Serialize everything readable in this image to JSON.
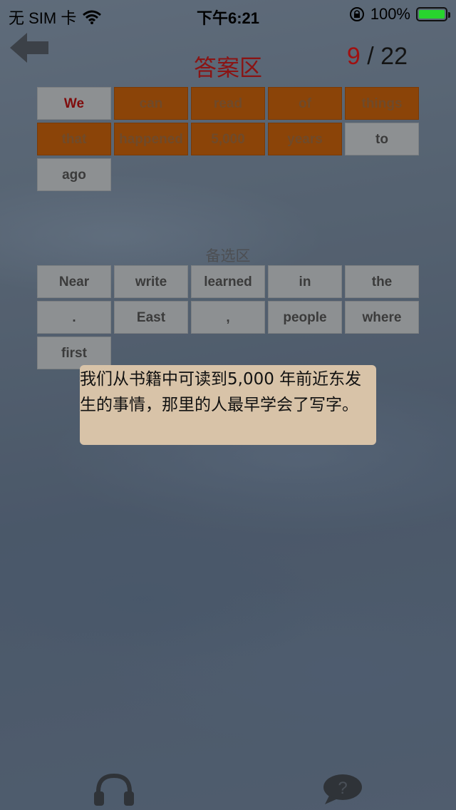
{
  "status_bar": {
    "carrier": "无 SIM 卡",
    "time": "下午6:21",
    "battery": "100%"
  },
  "header": {
    "title": "答案区",
    "counter_current": "9",
    "counter_sep": " / ",
    "counter_total": "22"
  },
  "answer_tiles": [
    {
      "text": "We",
      "state": "selected"
    },
    {
      "text": "can",
      "state": "placed"
    },
    {
      "text": "read",
      "state": "placed"
    },
    {
      "text": "of",
      "state": "placed"
    },
    {
      "text": "things",
      "state": "placed"
    },
    {
      "text": "that",
      "state": "placed"
    },
    {
      "text": "happened",
      "state": "placed"
    },
    {
      "text": "5,000",
      "state": "placed"
    },
    {
      "text": "years",
      "state": "placed"
    },
    {
      "text": "to",
      "state": "empty"
    },
    {
      "text": "ago",
      "state": "empty"
    }
  ],
  "candidate_label": "备选区",
  "candidate_tiles": [
    "Near",
    "write",
    "learned",
    "in",
    "the",
    ".",
    "East",
    ",",
    "people",
    "where",
    "first"
  ],
  "translation": "我们从书籍中可读到5,000 年前近东发生的事情，那里的人最早学会了写字。",
  "colors": {
    "title": "#8a1414",
    "tile_grey": "#8d9092",
    "tile_orange": "#8b4408",
    "battery": "#28d42e",
    "translation_bg": "#d8c3a8"
  },
  "icons": [
    "back-arrow-icon",
    "wifi-icon",
    "orientation-lock-icon",
    "battery-icon",
    "headphones-icon",
    "chat-bubble-icon"
  ]
}
